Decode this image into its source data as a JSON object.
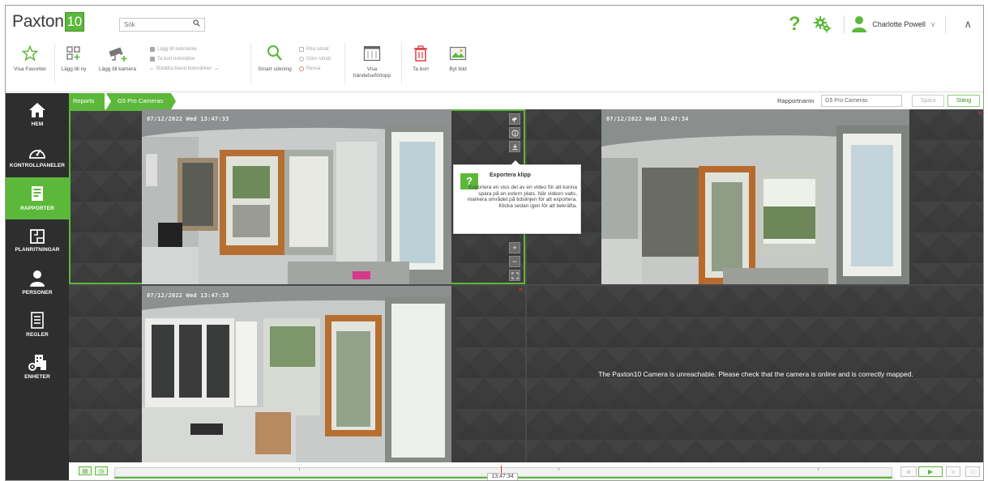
{
  "app": {
    "logo_text": "Paxton",
    "logo_num": "10"
  },
  "search": {
    "placeholder": "Sök"
  },
  "header": {
    "help_symbol": "?",
    "user_name": "Charlotte Powell",
    "user_chevron": "∨",
    "collapse_symbol": "∧"
  },
  "ribbon": {
    "visa_favoriter": "Visa Favoriter",
    "lagg_till_ny": "Lägg till ny",
    "lagg_till_kamera": "Lägg till kamera",
    "bookmarks": [
      "Lägg till bokmärke",
      "Ta bort bokmärke",
      "Bläddra bland bokmärken"
    ],
    "smart_sokning": "Smart sökning",
    "search_small": [
      "Rita rutnät",
      "Göm rutnät",
      "Rensa"
    ],
    "visa_handelse_line1": "Visa",
    "visa_handelse_line2": "händelseförlopp",
    "ta_bort": "Ta bort",
    "byt_bild": "Byt bild"
  },
  "sidebar": {
    "items": [
      {
        "label": "HEM",
        "icon": "home-icon"
      },
      {
        "label": "KONTROLLPANELER",
        "icon": "gauge-icon"
      },
      {
        "label": "RAPPORTER",
        "icon": "report-icon",
        "active": true
      },
      {
        "label": "PLANRITNINGAR",
        "icon": "floorplan-icon"
      },
      {
        "label": "PERSONER",
        "icon": "person-icon"
      },
      {
        "label": "REGLER",
        "icon": "rules-icon"
      },
      {
        "label": "ENHETER",
        "icon": "devices-icon"
      }
    ]
  },
  "breadcrumb": {
    "root": "Reports",
    "current": "G5 Pro Cameras"
  },
  "report": {
    "name_label": "Rapportnamn",
    "name_value": "G5 Pro Cameras",
    "save_label": "Spara",
    "close_label": "Stäng"
  },
  "cameras": {
    "tile1_time": "07/12/2022 Wed 13:47:33",
    "tile2_time": "07/12/2022 Wed 13:47:34",
    "tile3_time": "07/12/2022 Wed 13:47:33",
    "unreachable_msg": "The Paxton10 Camera is unreachable. Please check that the camera is online and is correctly mapped."
  },
  "tooltip": {
    "title": "Exportera klipp",
    "body": "Exportera en viss del av en video för att kunna spara på en extern plats. När videon valts, markera området på tidslinjen för att exportera. Klicka sedan igen för att bekräfta."
  },
  "timeline": {
    "current_time": "13:47:34"
  },
  "colors": {
    "brand_green": "#5cb83a",
    "sidebar": "#2e2e2e",
    "danger": "#d33333"
  }
}
